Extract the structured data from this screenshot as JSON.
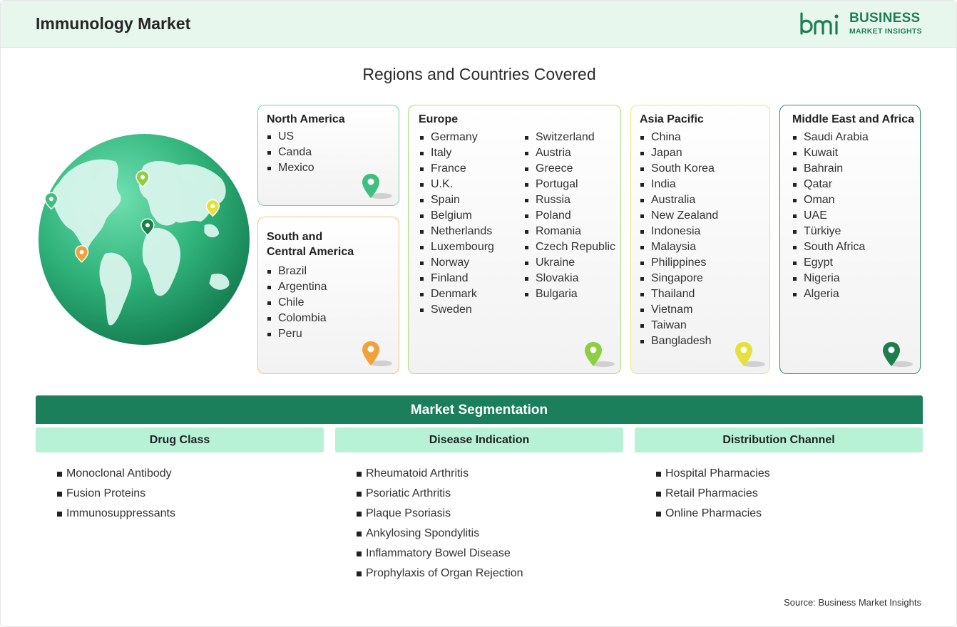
{
  "header": {
    "title": "Immunology Market",
    "logo": {
      "line1": "BUSINESS",
      "line2": "MARKET INSIGHTS",
      "color": "#1e7d54"
    }
  },
  "regions_title": "Regions and Countries Covered",
  "regions": {
    "north_america": {
      "title": "North America",
      "countries": [
        "US",
        "Canda",
        "Mexico"
      ],
      "pin_color": "#3fbf7f"
    },
    "south_central_america": {
      "title_line1": "South and",
      "title_line2": "Central America",
      "countries": [
        "Brazil",
        "Argentina",
        "Chile",
        "Colombia",
        "Peru"
      ],
      "pin_color": "#f0a23a"
    },
    "europe": {
      "title": "Europe",
      "countries_col1": [
        "Germany",
        "Italy",
        "France",
        "U.K.",
        "Spain",
        "Belgium",
        "Netherlands",
        "Luxembourg",
        "Norway",
        "Finland",
        "Denmark",
        "Sweden"
      ],
      "countries_col2": [
        "Switzerland",
        "Austria",
        "Greece",
        "Portugal",
        "Russia",
        "Poland",
        "Romania",
        "Czech Republic",
        "Ukraine",
        "Slovakia",
        "Bulgaria"
      ],
      "pin_color": "#8ccf3f"
    },
    "asia_pacific": {
      "title": "Asia Pacific",
      "countries": [
        "China",
        "Japan",
        "South Korea",
        "India",
        "Australia",
        "New Zealand",
        "Indonesia",
        "Malaysia",
        "Philippines",
        "Singapore",
        "Thailand",
        "Vietnam",
        "Taiwan",
        "Bangladesh"
      ],
      "pin_color": "#e6e03a"
    },
    "middle_east_africa": {
      "title": "Middle East and Africa",
      "countries": [
        "Saudi Arabia",
        "Kuwait",
        "Bahrain",
        "Qatar",
        "Oman",
        "UAE",
        "Türkiye",
        "South Africa",
        "Egypt",
        "Nigeria",
        "Algeria"
      ],
      "pin_color": "#1b7f4c"
    }
  },
  "segmentation": {
    "title": "Market Segmentation",
    "columns": [
      {
        "heading": "Drug Class",
        "items": [
          "Monoclonal Antibody",
          "Fusion Proteins",
          "Immunosuppressants"
        ]
      },
      {
        "heading": "Disease Indication",
        "items": [
          "Rheumatoid Arthritis",
          "Psoriatic Arthritis",
          "Plaque Psoriasis",
          "Ankylosing Spondylitis",
          "Inflammatory Bowel Disease",
          "Prophylaxis of Organ Rejection"
        ]
      },
      {
        "heading": "Distribution Channel",
        "items": [
          "Hospital Pharmacies",
          "Retail Pharmacies",
          "Online Pharmacies"
        ]
      }
    ]
  },
  "source": "Source: Business Market Insights",
  "colors": {
    "header_bg": "#e7f7ee",
    "segment_bar": "#1b7f5c",
    "segment_head": "#b7f2d6"
  }
}
